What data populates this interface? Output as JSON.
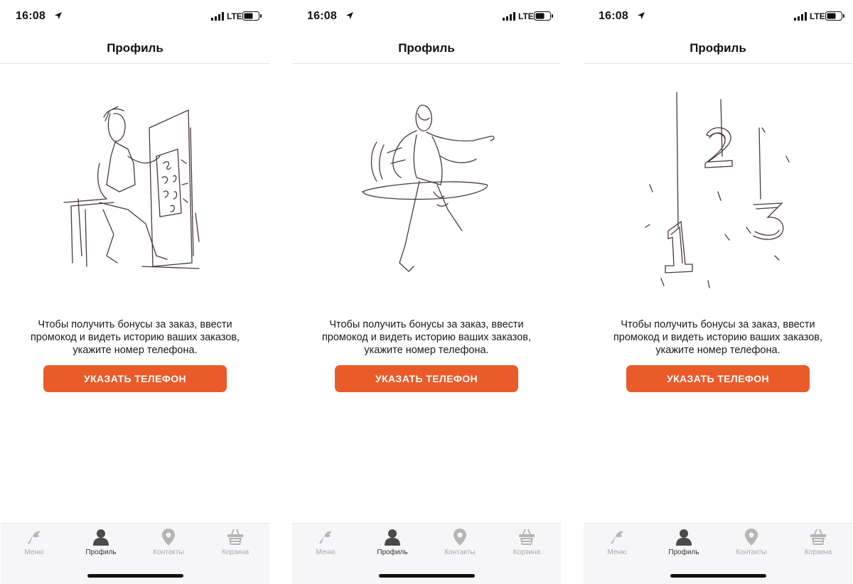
{
  "screens": [
    {
      "status": {
        "time": "16:08",
        "carrier": "LTE"
      },
      "nav": {
        "title": "Профиль"
      },
      "illustration": "sketch-person-at-board",
      "message": "Чтобы получить бонусы за заказ, ввести промокод и видеть историю ваших заказов, укажите номер телефона.",
      "button_label": "УКАЗАТЬ ТЕЛЕФОН",
      "tabs": [
        {
          "label": "Меню",
          "icon": "menu-icon",
          "active": false
        },
        {
          "label": "Профиль",
          "icon": "profile-icon",
          "active": true
        },
        {
          "label": "Контакты",
          "icon": "location-icon",
          "active": false
        },
        {
          "label": "Корзина",
          "icon": "basket-icon",
          "active": false
        }
      ]
    },
    {
      "status": {
        "time": "16:08",
        "carrier": "LTE"
      },
      "nav": {
        "title": "Профиль"
      },
      "illustration": "sketch-dancing-figure",
      "message": "Чтобы получить бонусы за заказ, ввести промокод и видеть историю ваших заказов, укажите номер телефона.",
      "button_label": "УКАЗАТЬ ТЕЛЕФОН",
      "tabs": [
        {
          "label": "Меню",
          "icon": "menu-icon",
          "active": false
        },
        {
          "label": "Профиль",
          "icon": "profile-icon",
          "active": true
        },
        {
          "label": "Контакты",
          "icon": "location-icon",
          "active": false
        },
        {
          "label": "Корзина",
          "icon": "basket-icon",
          "active": false
        }
      ]
    },
    {
      "status": {
        "time": "16:08",
        "carrier": "LTE"
      },
      "nav": {
        "title": "Профиль"
      },
      "illustration": "sketch-numbers-1-2-3",
      "message": "Чтобы получить бонусы за заказ, ввести промокод и видеть историю ваших заказов, укажите номер телефона.",
      "button_label": "УКАЗАТЬ ТЕЛЕФОН",
      "tabs": [
        {
          "label": "Меню",
          "icon": "menu-icon",
          "active": false
        },
        {
          "label": "Профиль",
          "icon": "profile-icon",
          "active": true
        },
        {
          "label": "Контакты",
          "icon": "location-icon",
          "active": false
        },
        {
          "label": "Корзина",
          "icon": "basket-icon",
          "active": false
        }
      ]
    }
  ],
  "colors": {
    "accent": "#ea5b2a",
    "tab_active": "#333333",
    "tab_inactive": "#a8a8a8",
    "sketch": "#4a3a3c"
  }
}
